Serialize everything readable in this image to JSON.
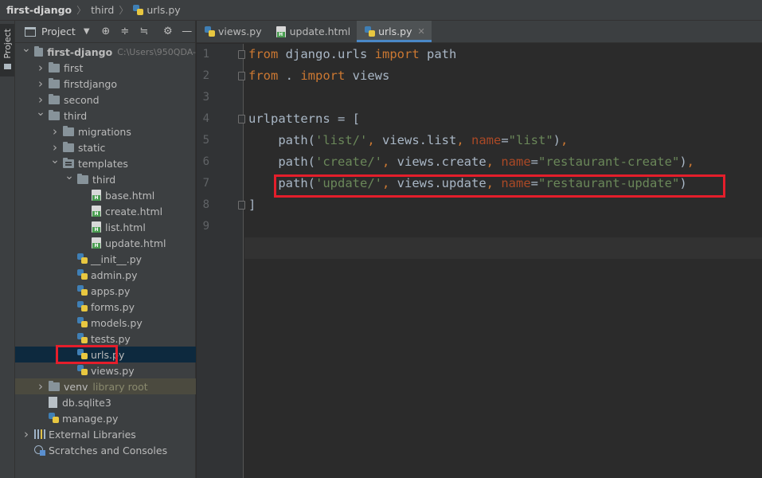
{
  "breadcrumb": {
    "project": "first-django",
    "folder": "third",
    "file": "urls.py"
  },
  "left_strip": {
    "label": "Project"
  },
  "project_panel": {
    "title": "Project",
    "icons": [
      "crosshair-icon",
      "expand-all-icon",
      "collapse-all-icon",
      "settings-icon",
      "minimize-icon"
    ],
    "tree": [
      {
        "label": "first-django",
        "extra": "C:\\Users\\950QDA-",
        "depth": 0,
        "type": "folder",
        "arrow": "down",
        "name": "tree-item-first-django"
      },
      {
        "label": "first",
        "depth": 1,
        "type": "folder",
        "arrow": "right",
        "name": "tree-item-first"
      },
      {
        "label": "firstdjango",
        "depth": 1,
        "type": "folder",
        "arrow": "right",
        "name": "tree-item-firstdjango"
      },
      {
        "label": "second",
        "depth": 1,
        "type": "folder",
        "arrow": "right",
        "name": "tree-item-second"
      },
      {
        "label": "third",
        "depth": 1,
        "type": "folder",
        "arrow": "down",
        "name": "tree-item-third"
      },
      {
        "label": "migrations",
        "depth": 2,
        "type": "folder",
        "arrow": "right",
        "name": "tree-item-migrations"
      },
      {
        "label": "static",
        "depth": 2,
        "type": "folder",
        "arrow": "right",
        "name": "tree-item-static"
      },
      {
        "label": "templates",
        "depth": 2,
        "type": "folder-res",
        "arrow": "down",
        "name": "tree-item-templates"
      },
      {
        "label": "third",
        "depth": 3,
        "type": "folder",
        "arrow": "down",
        "name": "tree-item-templates-third"
      },
      {
        "label": "base.html",
        "depth": 4,
        "type": "html",
        "name": "tree-item-base-html"
      },
      {
        "label": "create.html",
        "depth": 4,
        "type": "html",
        "name": "tree-item-create-html"
      },
      {
        "label": "list.html",
        "depth": 4,
        "type": "html",
        "name": "tree-item-list-html"
      },
      {
        "label": "update.html",
        "depth": 4,
        "type": "html",
        "name": "tree-item-update-html"
      },
      {
        "label": "__init__.py",
        "depth": 3,
        "type": "py",
        "name": "tree-item-init-py"
      },
      {
        "label": "admin.py",
        "depth": 3,
        "type": "py",
        "name": "tree-item-admin-py"
      },
      {
        "label": "apps.py",
        "depth": 3,
        "type": "py",
        "name": "tree-item-apps-py"
      },
      {
        "label": "forms.py",
        "depth": 3,
        "type": "py",
        "name": "tree-item-forms-py"
      },
      {
        "label": "models.py",
        "depth": 3,
        "type": "py",
        "name": "tree-item-models-py"
      },
      {
        "label": "tests.py",
        "depth": 3,
        "type": "py",
        "name": "tree-item-tests-py"
      },
      {
        "label": "urls.py",
        "depth": 3,
        "type": "py",
        "selected": true,
        "highlight": true,
        "name": "tree-item-urls-py"
      },
      {
        "label": "views.py",
        "depth": 3,
        "type": "py",
        "name": "tree-item-views-py"
      },
      {
        "label": "venv",
        "tag": "library root",
        "depth": 1,
        "type": "folder",
        "arrow": "right",
        "excluded": true,
        "name": "tree-item-venv"
      },
      {
        "label": "db.sqlite3",
        "depth": 1,
        "type": "file",
        "name": "tree-item-db-sqlite3"
      },
      {
        "label": "manage.py",
        "depth": 1,
        "type": "py",
        "name": "tree-item-manage-py"
      },
      {
        "label": "External Libraries",
        "depth": 0,
        "type": "lib",
        "arrow": "right",
        "name": "tree-item-external-libraries"
      },
      {
        "label": "Scratches and Consoles",
        "depth": 0,
        "type": "scratch",
        "name": "tree-item-scratches-and-consoles"
      }
    ]
  },
  "tabs": [
    {
      "label": "views.py",
      "icon": "python-file-icon",
      "name": "tab-views-py",
      "active": false,
      "close": false
    },
    {
      "label": "update.html",
      "icon": "html-file-icon",
      "name": "tab-update-html",
      "active": false,
      "close": false
    },
    {
      "label": "urls.py",
      "icon": "python-file-icon",
      "name": "tab-urls-py",
      "active": true,
      "close": true
    }
  ],
  "editor": {
    "current_line": 9,
    "highlighted_line": 7,
    "lines": [
      {
        "n": "1",
        "fold": true,
        "tokens": [
          [
            "kw",
            "from"
          ],
          [
            "plain",
            " django.urls "
          ],
          [
            "kw",
            "import"
          ],
          [
            "plain",
            " path"
          ]
        ]
      },
      {
        "n": "2",
        "fold": true,
        "tokens": [
          [
            "kw",
            "from"
          ],
          [
            "plain",
            " . "
          ],
          [
            "kw",
            "import"
          ],
          [
            "plain",
            " views"
          ]
        ]
      },
      {
        "n": "3",
        "tokens": []
      },
      {
        "n": "4",
        "fold": true,
        "tokens": [
          [
            "plain",
            "urlpatterns = ["
          ]
        ]
      },
      {
        "n": "5",
        "tokens": [
          [
            "plain",
            "    path("
          ],
          [
            "str",
            "'list/'"
          ],
          [
            "kw",
            ", "
          ],
          [
            "plain",
            "views.list"
          ],
          [
            "kw",
            ", "
          ],
          [
            "param",
            "name"
          ],
          [
            "plain",
            "="
          ],
          [
            "str",
            "\"list\""
          ],
          [
            "plain",
            ")"
          ],
          [
            "kw",
            ","
          ]
        ]
      },
      {
        "n": "6",
        "tokens": [
          [
            "plain",
            "    path("
          ],
          [
            "str",
            "'create/'"
          ],
          [
            "kw",
            ", "
          ],
          [
            "plain",
            "views.create"
          ],
          [
            "kw",
            ", "
          ],
          [
            "param",
            "name"
          ],
          [
            "plain",
            "="
          ],
          [
            "str",
            "\"restaurant-create\""
          ],
          [
            "plain",
            ")"
          ],
          [
            "kw",
            ","
          ]
        ]
      },
      {
        "n": "7",
        "tokens": [
          [
            "plain",
            "    path("
          ],
          [
            "str",
            "'update/'"
          ],
          [
            "kw",
            ", "
          ],
          [
            "plain",
            "views.update"
          ],
          [
            "kw",
            ", "
          ],
          [
            "param",
            "name"
          ],
          [
            "plain",
            "="
          ],
          [
            "str",
            "\"restaurant-update\""
          ],
          [
            "plain",
            ")"
          ]
        ]
      },
      {
        "n": "8",
        "fold": true,
        "tokens": [
          [
            "plain",
            "]"
          ]
        ]
      },
      {
        "n": "9",
        "tokens": []
      }
    ]
  }
}
